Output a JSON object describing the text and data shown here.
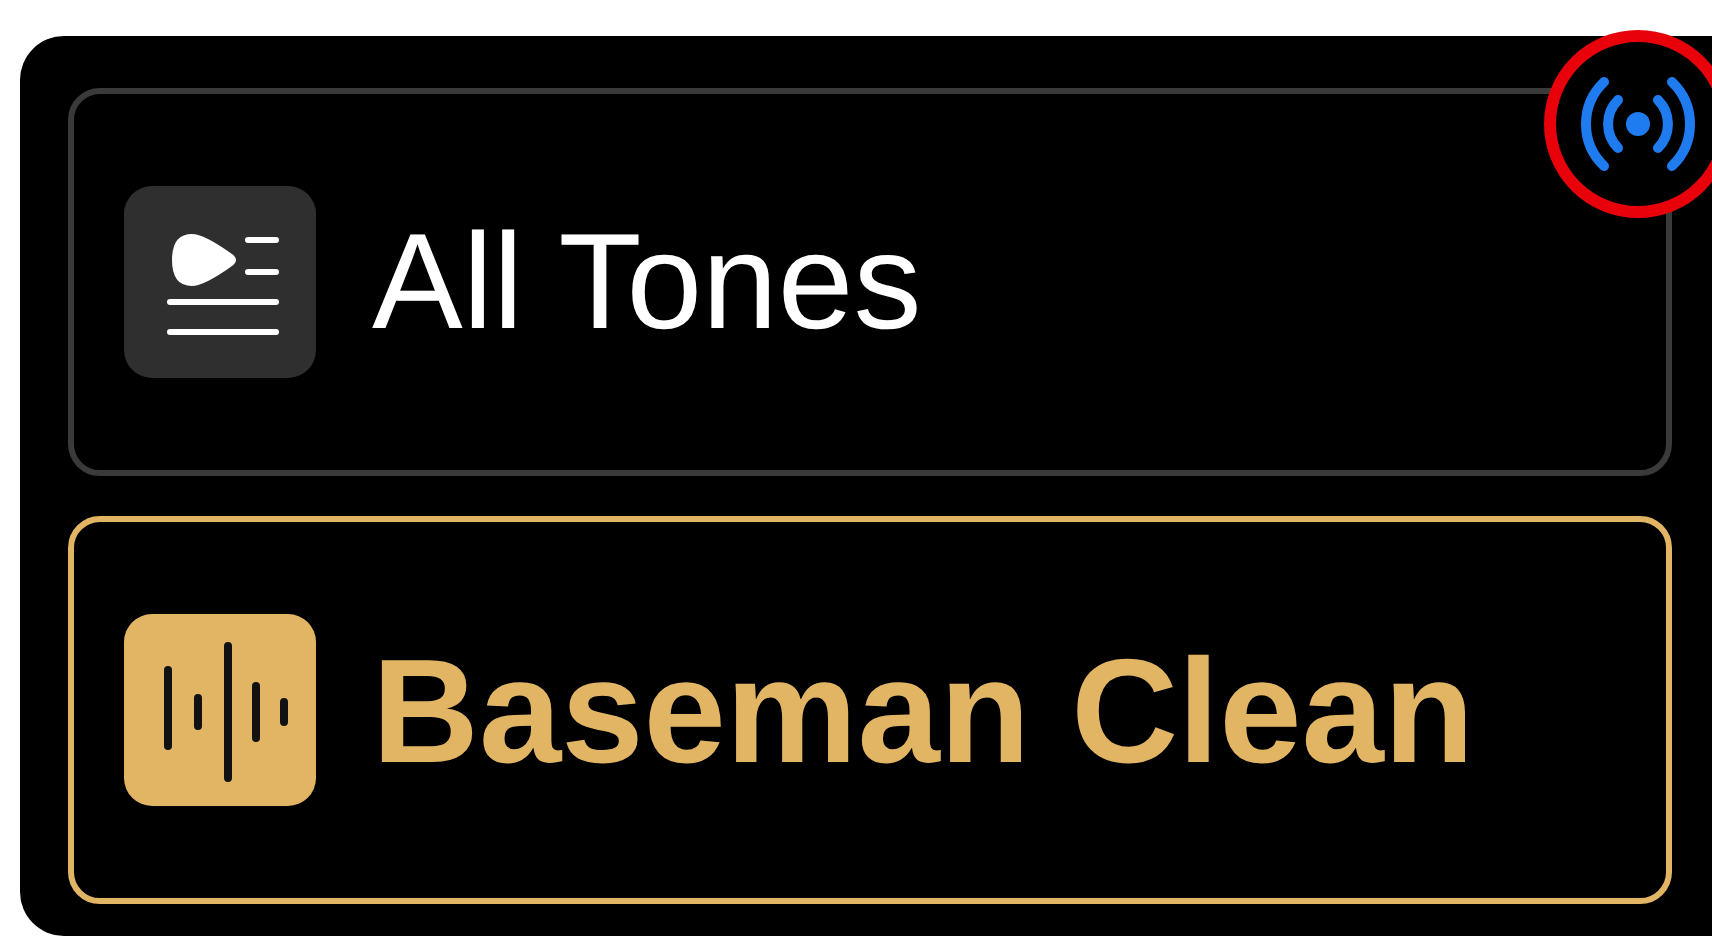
{
  "items": [
    {
      "label": "All Tones",
      "kind": "list",
      "selected": false
    },
    {
      "label": "Baseman Clean",
      "kind": "tone",
      "selected": true
    }
  ]
}
